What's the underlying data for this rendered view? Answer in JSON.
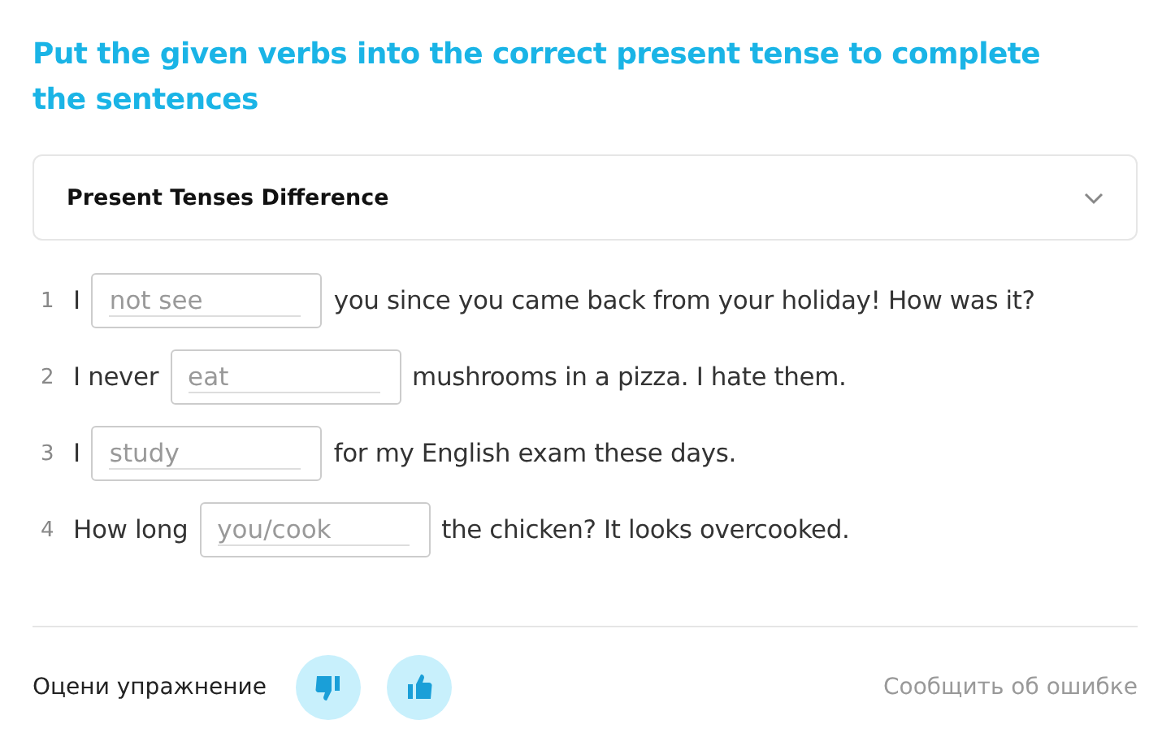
{
  "title": "Put the given verbs into the correct present tense to complete the sentences",
  "accordion": {
    "title": "Present Tenses Difference",
    "expanded": false
  },
  "items": [
    {
      "number": "1",
      "before": "I",
      "placeholder": "not see",
      "after": "you since you came back from your holiday! How was it?"
    },
    {
      "number": "2",
      "before": "I never",
      "placeholder": "eat",
      "after": "mushrooms in a pizza. I hate them."
    },
    {
      "number": "3",
      "before": "I",
      "placeholder": "study",
      "after": "for my English exam these days."
    },
    {
      "number": "4",
      "before": "How long",
      "placeholder": "you/cook",
      "after": "the chicken? It looks overcooked."
    }
  ],
  "footer": {
    "rate_label": "Оцени упражнение",
    "report_link": "Сообщить об ошибке"
  }
}
